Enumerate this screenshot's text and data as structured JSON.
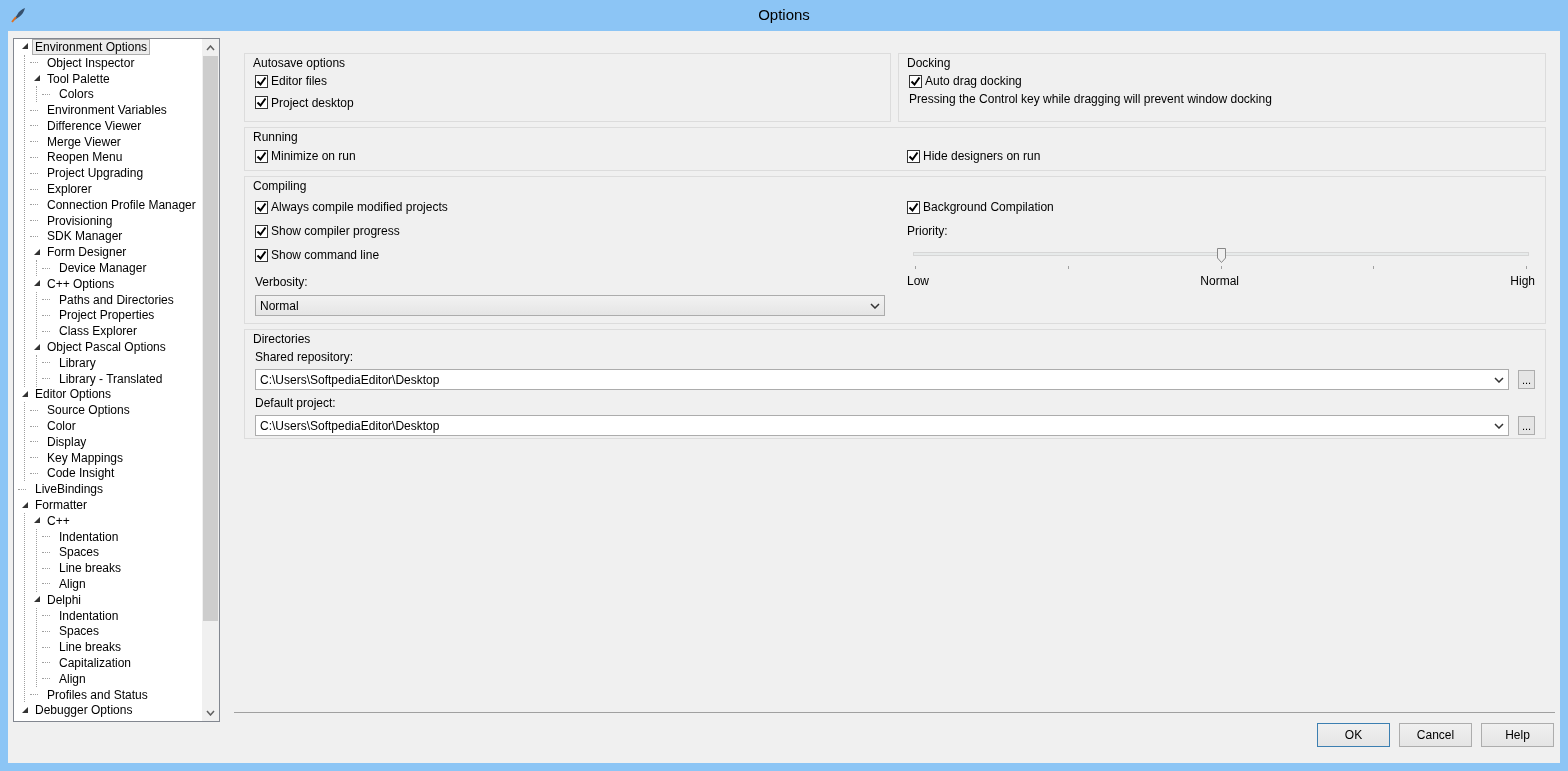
{
  "window": {
    "title": "Options"
  },
  "tree": [
    {
      "label": "Environment Options",
      "expanded": true,
      "selected": true,
      "children": [
        {
          "label": "Object Inspector",
          "selected": false
        },
        {
          "label": "Tool Palette",
          "expanded": true,
          "selected": false,
          "children": [
            {
              "label": "Colors",
              "selected": false
            }
          ]
        },
        {
          "label": "Environment Variables",
          "selected": false
        },
        {
          "label": "Difference Viewer",
          "selected": false
        },
        {
          "label": "Merge Viewer",
          "selected": false
        },
        {
          "label": "Reopen Menu",
          "selected": false
        },
        {
          "label": "Project Upgrading",
          "selected": false
        },
        {
          "label": "Explorer",
          "selected": false
        },
        {
          "label": "Connection Profile Manager",
          "selected": false
        },
        {
          "label": "Provisioning",
          "selected": false
        },
        {
          "label": "SDK Manager",
          "selected": false
        },
        {
          "label": "Form Designer",
          "expanded": true,
          "selected": false,
          "children": [
            {
              "label": "Device Manager",
              "selected": false
            }
          ]
        },
        {
          "label": "C++ Options",
          "expanded": true,
          "selected": false,
          "children": [
            {
              "label": "Paths and Directories",
              "selected": false
            },
            {
              "label": "Project Properties",
              "selected": false
            },
            {
              "label": "Class Explorer",
              "selected": false
            }
          ]
        },
        {
          "label": "Object Pascal Options",
          "expanded": true,
          "selected": false,
          "children": [
            {
              "label": "Library",
              "selected": false
            },
            {
              "label": "Library - Translated",
              "selected": false
            }
          ]
        }
      ]
    },
    {
      "label": "Editor Options",
      "expanded": true,
      "selected": false,
      "children": [
        {
          "label": "Source Options",
          "selected": false
        },
        {
          "label": "Color",
          "selected": false
        },
        {
          "label": "Display",
          "selected": false
        },
        {
          "label": "Key Mappings",
          "selected": false
        },
        {
          "label": "Code Insight",
          "selected": false
        }
      ]
    },
    {
      "label": "LiveBindings",
      "selected": false
    },
    {
      "label": "Formatter",
      "expanded": true,
      "selected": false,
      "children": [
        {
          "label": "C++",
          "expanded": true,
          "selected": false,
          "children": [
            {
              "label": "Indentation",
              "selected": false
            },
            {
              "label": "Spaces",
              "selected": false
            },
            {
              "label": "Line breaks",
              "selected": false
            },
            {
              "label": "Align",
              "selected": false
            }
          ]
        },
        {
          "label": "Delphi",
          "expanded": true,
          "selected": false,
          "children": [
            {
              "label": "Indentation",
              "selected": false
            },
            {
              "label": "Spaces",
              "selected": false
            },
            {
              "label": "Line breaks",
              "selected": false
            },
            {
              "label": "Capitalization",
              "selected": false
            },
            {
              "label": "Align",
              "selected": false
            }
          ]
        },
        {
          "label": "Profiles and Status",
          "selected": false
        }
      ]
    },
    {
      "label": "Debugger Options",
      "expanded": true,
      "selected": false
    }
  ],
  "autosave": {
    "title": "Autosave options",
    "options": [
      {
        "label": "Editor files",
        "checked": true
      },
      {
        "label": "Project desktop",
        "checked": true
      }
    ]
  },
  "docking": {
    "title": "Docking",
    "options": [
      {
        "label": "Auto drag docking",
        "checked": true
      }
    ],
    "note": "Pressing the Control key while dragging will prevent window docking"
  },
  "running": {
    "title": "Running",
    "left": [
      {
        "label": "Minimize on run",
        "checked": true
      }
    ],
    "right": [
      {
        "label": "Hide designers on run",
        "checked": true
      }
    ]
  },
  "compiling": {
    "title": "Compiling",
    "options": [
      {
        "label": "Always compile modified projects",
        "checked": true
      },
      {
        "label": "Show compiler progress",
        "checked": true
      },
      {
        "label": "Show command line",
        "checked": true
      }
    ],
    "verbosity": {
      "label": "Verbosity:",
      "value": "Normal"
    },
    "background": {
      "label": "Background Compilation",
      "checked": true
    },
    "priority": {
      "label": "Priority:",
      "level": 0.5,
      "tick_labels": [
        "Low",
        "Normal",
        "High"
      ]
    }
  },
  "directories": {
    "title": "Directories",
    "fields": [
      {
        "label": "Shared repository:",
        "value": "C:\\Users\\SoftpediaEditor\\Desktop",
        "browse": "..."
      },
      {
        "label": "Default project:",
        "value": "C:\\Users\\SoftpediaEditor\\Desktop",
        "browse": "..."
      }
    ]
  },
  "buttons": [
    {
      "label": "OK",
      "default": true
    },
    {
      "label": "Cancel",
      "default": false
    },
    {
      "label": "Help",
      "default": false
    }
  ]
}
